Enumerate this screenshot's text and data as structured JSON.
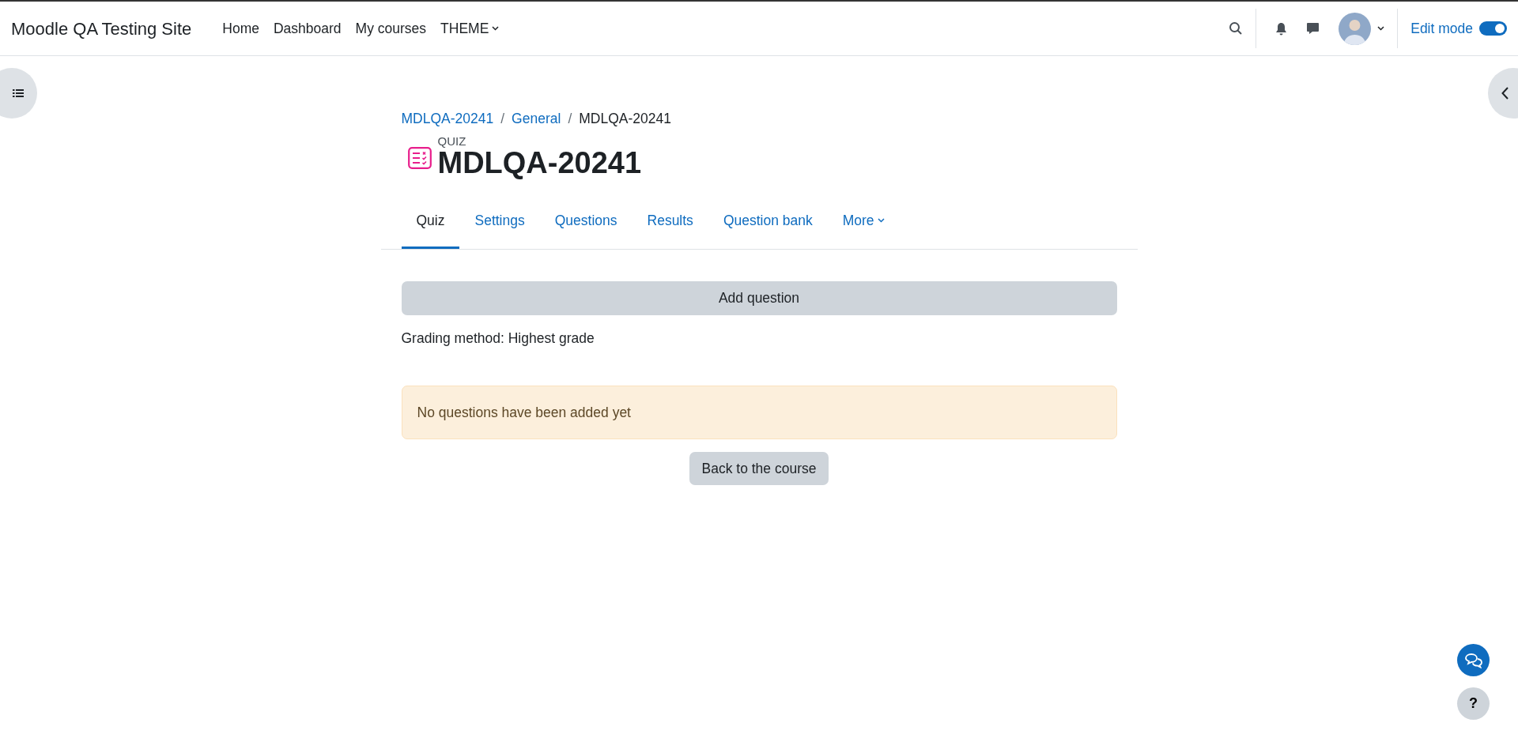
{
  "site_name": "Moodle QA Testing Site",
  "nav_items": [
    {
      "label": "Home",
      "dropdown": false
    },
    {
      "label": "Dashboard",
      "dropdown": false
    },
    {
      "label": "My courses",
      "dropdown": false
    },
    {
      "label": "THEME",
      "dropdown": true
    }
  ],
  "edit_mode": {
    "label": "Edit mode",
    "on": true
  },
  "breadcrumb": [
    {
      "kind": "link",
      "label": "MDLQA-20241"
    },
    {
      "kind": "separator",
      "label": "/"
    },
    {
      "kind": "link",
      "label": "General"
    },
    {
      "kind": "separator",
      "label": "/"
    },
    {
      "kind": "current",
      "label": "MDLQA-20241"
    }
  ],
  "activity": {
    "type_label": "QUIZ",
    "title": "MDLQA-20241"
  },
  "tabs": [
    {
      "label": "Quiz",
      "selected": true,
      "dropdown": false
    },
    {
      "label": "Settings",
      "selected": false,
      "dropdown": false
    },
    {
      "label": "Questions",
      "selected": false,
      "dropdown": false
    },
    {
      "label": "Results",
      "selected": false,
      "dropdown": false
    },
    {
      "label": "Question bank",
      "selected": false,
      "dropdown": false
    },
    {
      "label": "More",
      "selected": false,
      "dropdown": true
    }
  ],
  "add_question_button": "Add question",
  "grading_method": "Grading method: Highest grade",
  "alert": "No questions have been added yet",
  "back_button": "Back to the course",
  "help_button": "?"
}
